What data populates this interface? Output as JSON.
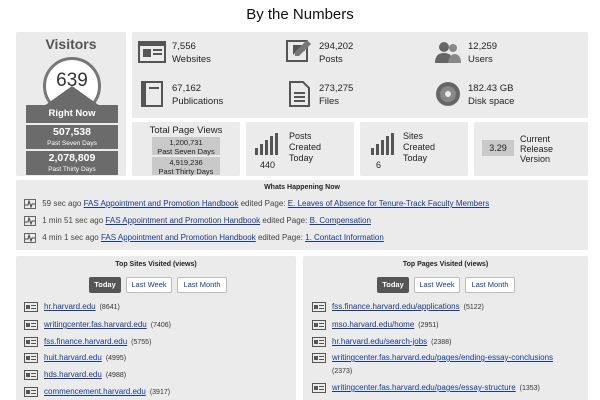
{
  "page_title": "By the Numbers",
  "visitors": {
    "title": "Visitors",
    "now_count": "639",
    "now_label": "Right Now",
    "seven_days_count": "507,538",
    "seven_days_label": "Past Seven Days",
    "thirty_days_count": "2,078,809",
    "thirty_days_label": "Past Thirty Days"
  },
  "stats": {
    "websites": {
      "value": "7,556",
      "label": "Websites",
      "icon": "websites-icon"
    },
    "posts": {
      "value": "294,202",
      "label": "Posts",
      "icon": "posts-icon"
    },
    "users": {
      "value": "12,259",
      "label": "Users",
      "icon": "users-icon"
    },
    "publications": {
      "value": "67,162",
      "label": "Publications",
      "icon": "publications-icon"
    },
    "files": {
      "value": "273,275",
      "label": "Files",
      "icon": "files-icon"
    },
    "disk": {
      "value": "182.43 GB",
      "label": "Disk space",
      "icon": "disk-icon"
    }
  },
  "page_views": {
    "label": "Total Page Views",
    "seven_count": "1,200,731",
    "seven_label": "Past Seven Days",
    "thirty_count": "4,919,236",
    "thirty_label": "Past Thirty Days"
  },
  "posts_today": {
    "label_1": "Posts",
    "label_2": "Created",
    "label_3": "Today",
    "count": "440"
  },
  "sites_today": {
    "label_1": "Sites",
    "label_2": "Created",
    "label_3": "Today",
    "count": "6"
  },
  "release": {
    "value": "3.29",
    "label_1": "Current",
    "label_2": "Release",
    "label_3": "Version"
  },
  "happening": {
    "title": "Whats Happening Now",
    "items": [
      {
        "time": "59 sec ago",
        "site": "FAS Appointment and Promotion Handbook",
        "action": "edited Page:",
        "page": "E. Leaves of Absence for Tenure-Track Faculty Members"
      },
      {
        "time": "1 min 51 sec ago",
        "site": "FAS Appointment and Promotion Handbook",
        "action": "edited Page:",
        "page": "B. Compensation"
      },
      {
        "time": "4 min 1 sec ago",
        "site": "FAS Appointment and Promotion Handbook",
        "action": "edited Page:",
        "page": "1. Contact Information"
      }
    ]
  },
  "top_sites": {
    "title": "Top Sites Visited (views)",
    "tabs": [
      "Today",
      "Last Week",
      "Last Month"
    ],
    "active_tab": "Today",
    "items": [
      {
        "url": "hr.harvard.edu",
        "count": "(8641)"
      },
      {
        "url": "writingcenter.fas.harvard.edu",
        "count": "(7406)"
      },
      {
        "url": "fss.finance.harvard.edu",
        "count": "(5755)"
      },
      {
        "url": "huit.harvard.edu",
        "count": "(4995)"
      },
      {
        "url": "hds.harvard.edu",
        "count": "(4988)"
      },
      {
        "url": "commencement.harvard.edu",
        "count": "(3917)"
      }
    ]
  },
  "top_pages": {
    "title": "Top Pages Visited (views)",
    "tabs": [
      "Today",
      "Last Week",
      "Last Month"
    ],
    "active_tab": "Today",
    "items": [
      {
        "url": "fss.finance.harvard.edu/applications",
        "count": "(5122)"
      },
      {
        "url": "mso.harvard.edu/home",
        "count": "(2951)"
      },
      {
        "url": "hr.harvard.edu/search-jobs",
        "count": "(2388)"
      },
      {
        "url": "writingcenter.fas.harvard.edu/pages/ending-essay-conclusions",
        "count": "(2373)"
      },
      {
        "url": "writingcenter.fas.harvard.edu/pages/essay-structure",
        "count": "(1353)"
      }
    ]
  }
}
